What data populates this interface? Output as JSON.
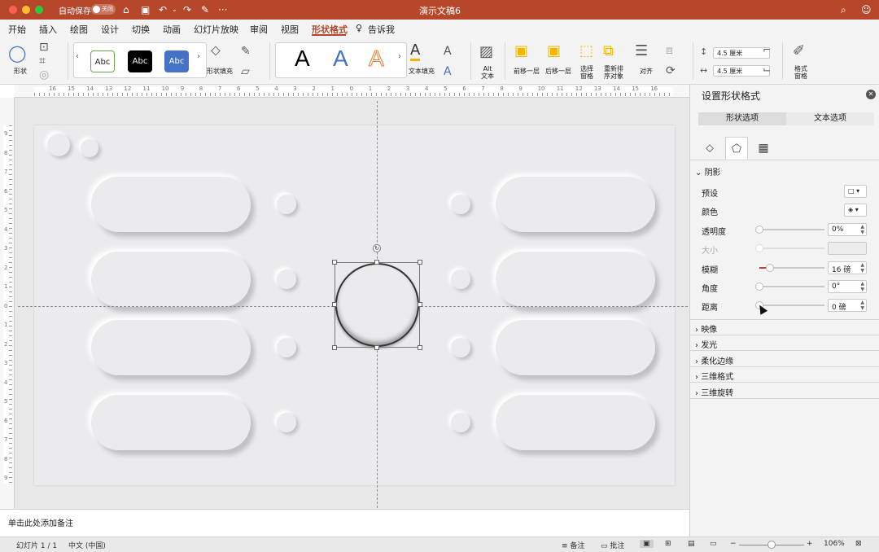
{
  "window": {
    "title": "演示文稿6",
    "autosave_label": "自动保存",
    "autosave_state": "关闭"
  },
  "tabs": [
    "开始",
    "插入",
    "绘图",
    "设计",
    "切换",
    "动画",
    "幻灯片放映",
    "审阅",
    "视图",
    "形状格式",
    "告诉我"
  ],
  "active_tab": "形状格式",
  "share_label": "共享",
  "comment_label": "批注",
  "ribbon": {
    "shape_label": "形状",
    "style_sample": "Abc",
    "shape_fill_label": "形状填充",
    "wordart_sample": "A",
    "text_fill_label": "文本填充",
    "alt_text_label": "Alt\n文本",
    "bring_forward": "前移一层",
    "send_backward": "后移一层",
    "selection_pane": "选择\n窗格",
    "reorder": "重新排\n序对象",
    "align": "对齐",
    "height_value": "4.5 厘米",
    "width_value": "4.5 厘米",
    "format_pane": "格式\n窗格"
  },
  "ruler_h": [
    "16",
    "15",
    "14",
    "13",
    "12",
    "11",
    "10",
    "9",
    "8",
    "7",
    "6",
    "5",
    "4",
    "3",
    "2",
    "1",
    "0",
    "1",
    "2",
    "3",
    "4",
    "5",
    "6",
    "7",
    "8",
    "9",
    "10",
    "11",
    "12",
    "13",
    "14",
    "15",
    "16"
  ],
  "ruler_v": [
    "9",
    "8",
    "7",
    "6",
    "5",
    "4",
    "3",
    "2",
    "1",
    "0",
    "1",
    "2",
    "3",
    "4",
    "5",
    "6",
    "7",
    "8",
    "9"
  ],
  "notes_placeholder": "单击此处添加备注",
  "status": {
    "slide_info": "幻灯片 1 / 1",
    "language": "中文 (中国)",
    "notes": "备注",
    "comments": "批注",
    "zoom": "106%"
  },
  "panel": {
    "title": "设置形状格式",
    "tab_shape": "形状选项",
    "tab_text": "文本选项",
    "section_shadow": "阴影",
    "preset_label": "预设",
    "color_label": "颜色",
    "transparency_label": "透明度",
    "transparency_value": "0%",
    "transparency_level": 0,
    "size_label": "大小",
    "blur_label": "模糊",
    "blur_value": "16 磅",
    "blur_level": 0.16,
    "angle_label": "角度",
    "angle_value": "0°",
    "angle_level": 0,
    "distance_label": "距离",
    "distance_value": "0 磅",
    "distance_level": 0,
    "collapsed_sections": [
      "映像",
      "发光",
      "柔化边缘",
      "三维格式",
      "三维旋转"
    ]
  },
  "colors": {
    "accent": "#b7472a",
    "slide_bg": "#ebebee"
  }
}
